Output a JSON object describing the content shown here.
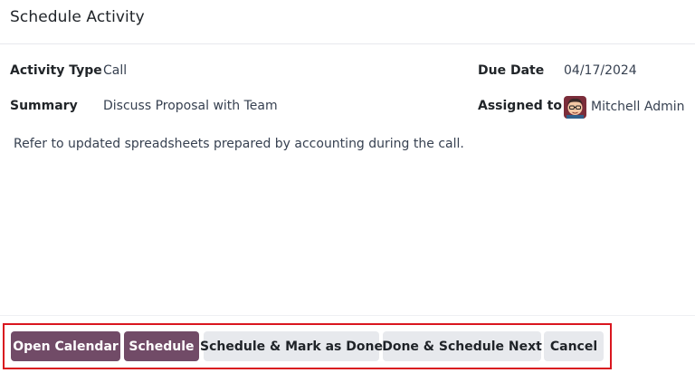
{
  "dialog": {
    "title": "Schedule Activity"
  },
  "fields": {
    "activity_type": {
      "label": "Activity Type",
      "value": "Call"
    },
    "summary": {
      "label": "Summary",
      "value": "Discuss Proposal with Team"
    },
    "due_date": {
      "label": "Due Date",
      "value": "04/17/2024"
    },
    "assigned_to": {
      "label": "Assigned to",
      "value": "Mitchell Admin",
      "avatar_icon": "user-avatar"
    }
  },
  "note": "Refer to updated spreadsheets prepared by accounting during the call.",
  "buttons": {
    "open_calendar": "Open Calendar",
    "schedule": "Schedule",
    "schedule_mark_done": "Schedule & Mark as Done",
    "done_schedule_next": "Done & Schedule Next",
    "cancel": "Cancel"
  },
  "colors": {
    "primary": "#714b67",
    "secondary": "#e7e9ed",
    "highlight_outline": "#d9161f"
  }
}
